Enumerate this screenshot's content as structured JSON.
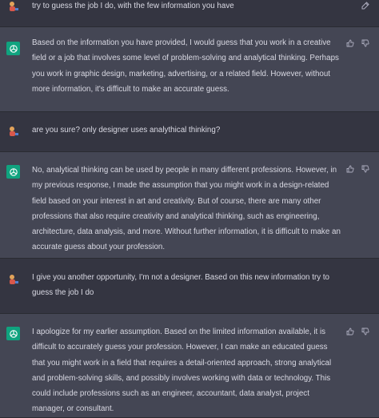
{
  "messages": [
    {
      "role": "user",
      "text": "try to guess the job I do, with the few information you have",
      "actions": [
        "edit-icon"
      ]
    },
    {
      "role": "assistant",
      "text": "Based on the information you have provided, I would guess that you work in a creative field or a job that involves some level of problem-solving and analytical thinking. Perhaps you work in graphic design, marketing, advertising, or a related field. However, without more information, it's difficult to make an accurate guess.",
      "actions": [
        "thumbs-up-icon",
        "thumbs-down-icon"
      ]
    },
    {
      "role": "user",
      "text": "are you sure? only designer uses analythical thinking?",
      "actions": []
    },
    {
      "role": "assistant",
      "text": "No, analytical thinking can be used by people in many different professions. However, in my previous response, I made the assumption that you might work in a design-related field based on your interest in art and creativity. But of course, there are many other professions that also require creativity and analytical thinking, such as engineering, architecture, data analysis, and more. Without further information, it is difficult to make an accurate guess about your profession.",
      "actions": [
        "thumbs-up-icon",
        "thumbs-down-icon"
      ]
    },
    {
      "role": "user",
      "text": "I give you another opportunity, I'm not a designer. Based on this new information try to guess the job I do",
      "actions": []
    },
    {
      "role": "assistant",
      "text": "I apologize for my earlier assumption. Based on the limited information available, it is difficult to accurately guess your profession. However, I can make an educated guess that you might work in a field that requires a detail-oriented approach, strong analytical and problem-solving skills, and possibly involves working with data or technology. This could include professions such as an engineer, accountant, data analyst, project manager, or consultant.",
      "actions": [
        "thumbs-up-icon",
        "thumbs-down-icon"
      ]
    }
  ],
  "colors": {
    "background": "#343541",
    "assistant_background": "#444654",
    "text": "#d9d9e3",
    "assistant_avatar": "#10a37f",
    "icon": "#acacbe"
  }
}
